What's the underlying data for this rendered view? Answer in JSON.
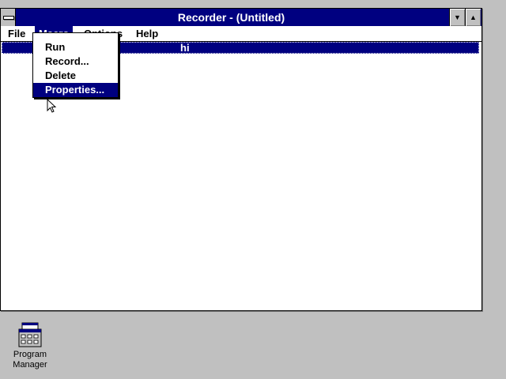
{
  "window": {
    "title": "Recorder - (Untitled)",
    "minimize_glyph": "▼",
    "maximize_glyph": "▲"
  },
  "menubar": {
    "items": [
      {
        "label": "File"
      },
      {
        "label": "Macro"
      },
      {
        "label": "Options"
      },
      {
        "label": "Help"
      }
    ]
  },
  "macro_menu": {
    "items": [
      {
        "label": "Run"
      },
      {
        "label": "Record..."
      },
      {
        "label": "Delete"
      },
      {
        "label": "Properties..."
      }
    ],
    "selected": "Properties..."
  },
  "macro_list": {
    "rows": [
      {
        "name": "hi",
        "selected": true
      }
    ]
  },
  "desktop": {
    "icons": [
      {
        "label": "Program Manager",
        "icon": "program-manager-icon"
      }
    ]
  },
  "colors": {
    "titlebar": "#000080",
    "selection": "#000080",
    "desktop": "#c0c0c0",
    "window_bg": "#ffffff"
  }
}
